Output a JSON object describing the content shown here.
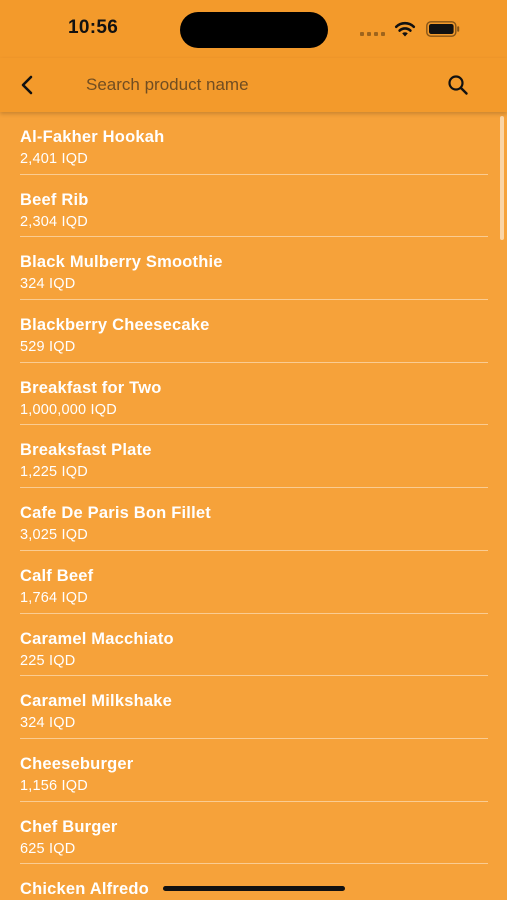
{
  "status_bar": {
    "time": "10:56"
  },
  "header": {
    "back_icon": "chevron-left-icon",
    "search_placeholder": "Search product name",
    "search_value": "",
    "search_icon": "search-icon"
  },
  "currency": "IQD",
  "products": [
    {
      "name": "Al-Fakher Hookah",
      "price": "2,401 IQD"
    },
    {
      "name": "Beef Rib",
      "price": "2,304 IQD"
    },
    {
      "name": "Black Mulberry Smoothie",
      "price": "324 IQD"
    },
    {
      "name": "Blackberry Cheesecake",
      "price": "529 IQD"
    },
    {
      "name": "Breakfast for Two",
      "price": "1,000,000 IQD"
    },
    {
      "name": "Breaksfast Plate",
      "price": "1,225 IQD"
    },
    {
      "name": "Cafe De Paris Bon Fillet",
      "price": "3,025 IQD"
    },
    {
      "name": "Calf Beef",
      "price": "1,764 IQD"
    },
    {
      "name": "Caramel Macchiato",
      "price": "225 IQD"
    },
    {
      "name": "Caramel Milkshake",
      "price": "324 IQD"
    },
    {
      "name": "Cheeseburger",
      "price": "1,156 IQD"
    },
    {
      "name": "Chef Burger",
      "price": "625 IQD"
    },
    {
      "name": "Chicken Alfredo",
      "price": ""
    }
  ],
  "colors": {
    "background": "#F6A23A",
    "app_bar": "#F39A2B",
    "text": "#FFFFFF"
  }
}
